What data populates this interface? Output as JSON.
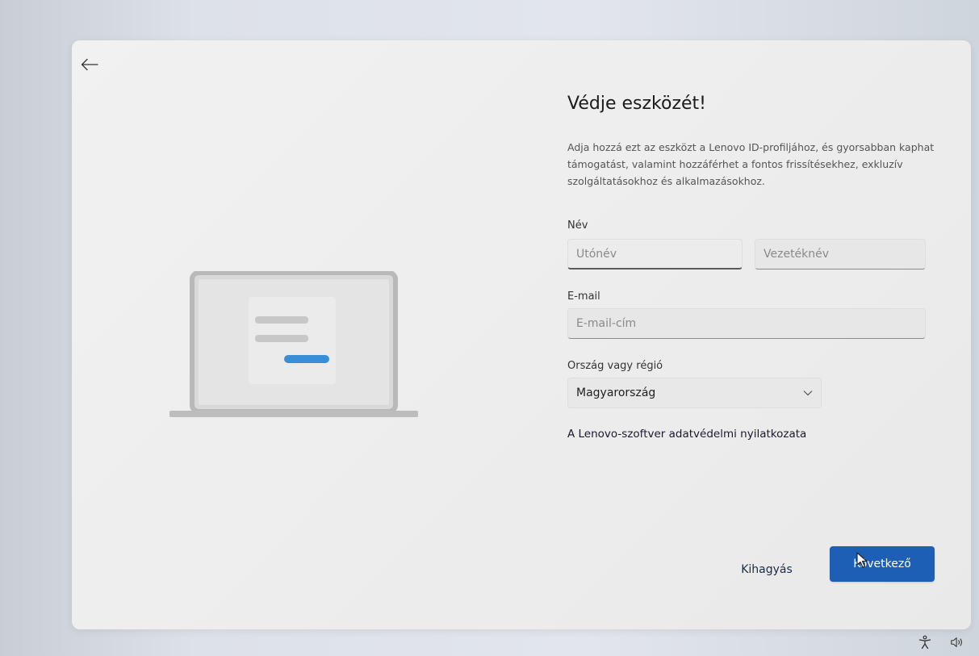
{
  "header": {
    "title": "Védje eszközét!",
    "description": "Adja hozzá ezt az eszközt a Lenovo ID-profiljához, és gyorsabban kaphat támogatást, valamint hozzáférhet a fontos frissítésekhez, exkluzív szolgáltatásokhoz és alkalmazásokhoz."
  },
  "form": {
    "name_label": "Név",
    "first_name_placeholder": "Utónév",
    "last_name_placeholder": "Vezetéknév",
    "email_label": "E-mail",
    "email_placeholder": "E-mail-cím",
    "country_label": "Ország vagy régió",
    "country_value": "Magyarország"
  },
  "privacy_link": "A Lenovo-szoftver adatvédelmi nyilatkozata",
  "buttons": {
    "skip": "Kihagyás",
    "next": "Következő"
  },
  "icons": {
    "back": "arrow-left-icon",
    "dropdown": "chevron-down-icon",
    "accessibility": "accessibility-icon",
    "volume": "volume-icon"
  },
  "colors": {
    "accent": "#1c5fb5"
  }
}
